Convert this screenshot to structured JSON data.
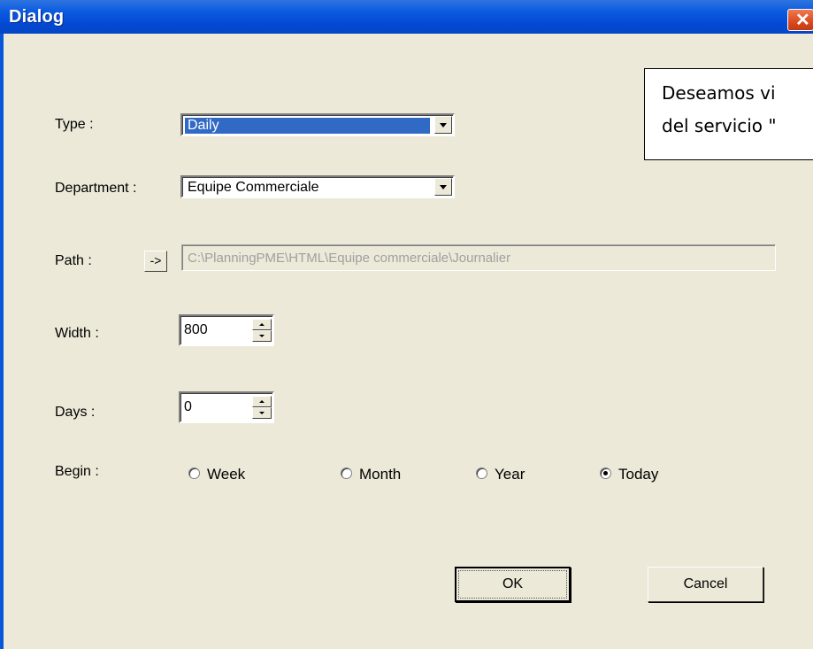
{
  "window": {
    "title": "Dialog"
  },
  "form": {
    "type": {
      "label": "Type :",
      "value": "Daily"
    },
    "department": {
      "label": "Department :",
      "value": "Equipe Commerciale"
    },
    "path": {
      "label": "Path :",
      "browse_label": "->",
      "value": "C:\\PlanningPME\\HTML\\Equipe commerciale\\Journalier"
    },
    "width": {
      "label": "Width :",
      "value": "800"
    },
    "days": {
      "label": "Days :",
      "value": "0"
    },
    "begin": {
      "label": "Begin :",
      "options": [
        {
          "label": "Week",
          "checked": false
        },
        {
          "label": "Month",
          "checked": false
        },
        {
          "label": "Year",
          "checked": false
        },
        {
          "label": "Today",
          "checked": true
        }
      ]
    }
  },
  "buttons": {
    "ok": "OK",
    "cancel": "Cancel"
  },
  "tooltip": {
    "line1": "Deseamos vi",
    "line2": "del servicio \""
  },
  "colors": {
    "titlebar": "#0449d4",
    "selection": "#316ac5",
    "close": "#d94a20",
    "face": "#ece9d8"
  }
}
